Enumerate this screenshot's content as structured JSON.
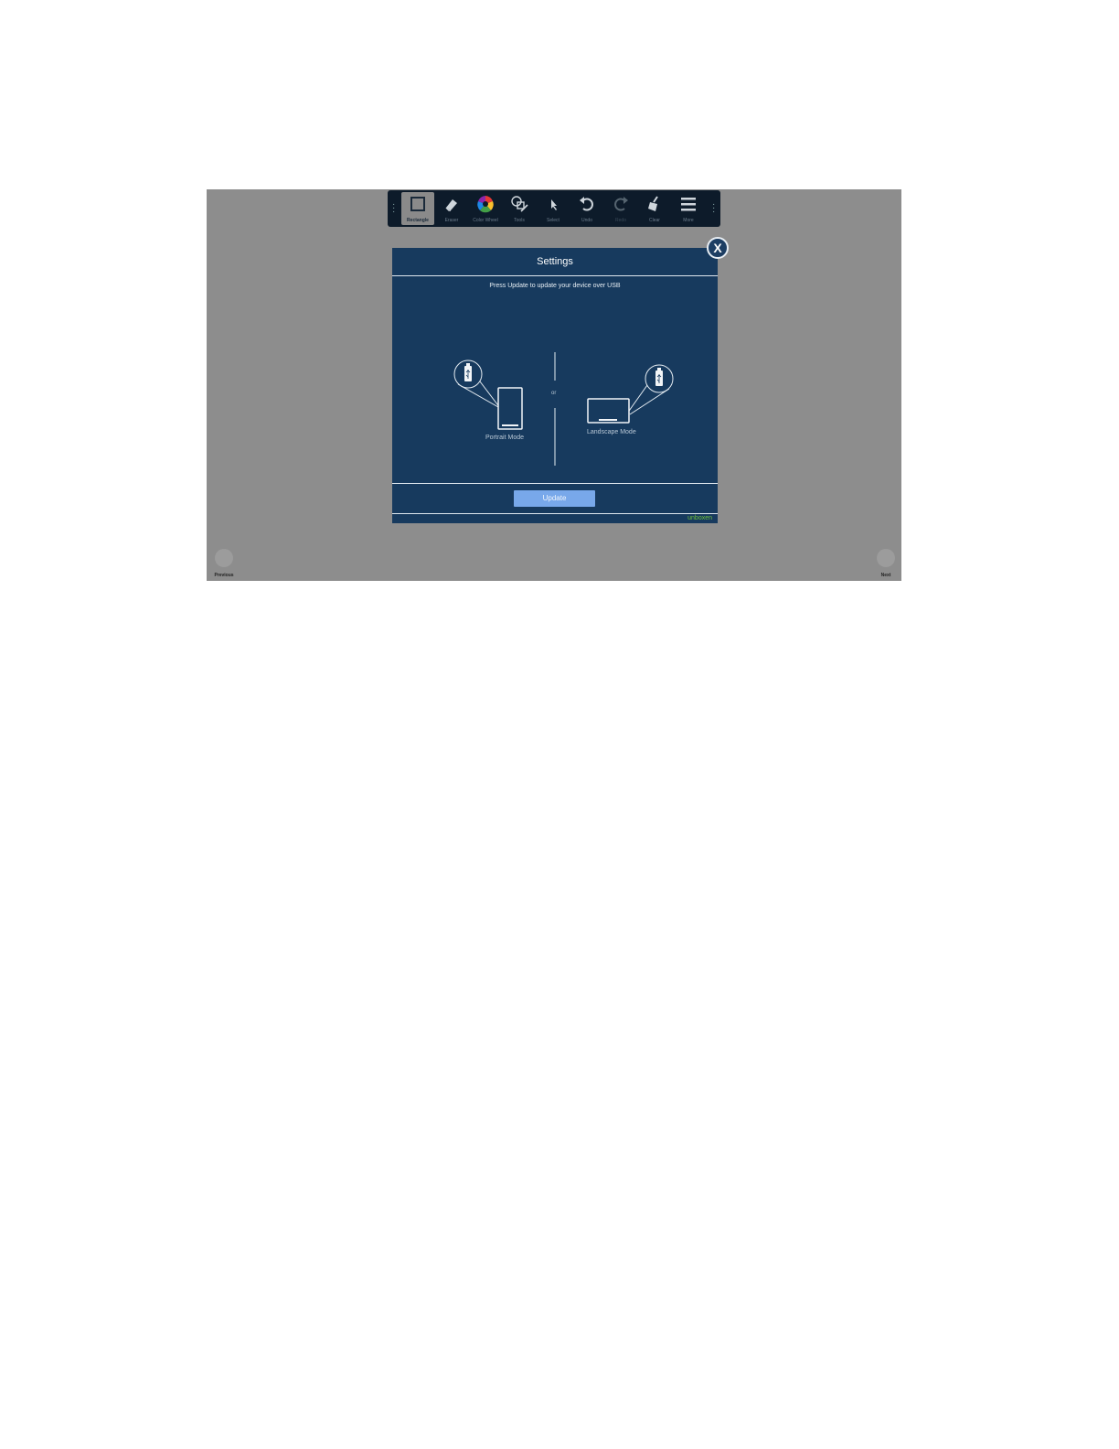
{
  "toolbar": {
    "items": [
      {
        "label": "Rectangle",
        "icon": "rectangle-icon",
        "active": true
      },
      {
        "label": "Eraser",
        "icon": "eraser-icon"
      },
      {
        "label": "Color Wheel",
        "icon": "color-wheel-icon"
      },
      {
        "label": "Tools",
        "icon": "tools-icon"
      },
      {
        "label": "Select",
        "icon": "pointer-icon"
      },
      {
        "label": "Undo",
        "icon": "undo-icon"
      },
      {
        "label": "Redo",
        "icon": "redo-icon"
      },
      {
        "label": "Clear",
        "icon": "broom-icon"
      },
      {
        "label": "More",
        "icon": "menu-icon"
      }
    ]
  },
  "modal": {
    "title": "Settings",
    "instruction": "Press Update to update your device over USB",
    "portrait_label": "Portrait Mode",
    "or_label": "or",
    "landscape_label": "Landscape Mode",
    "update_label": "Update",
    "brand": "unboxen",
    "close_label": "X"
  },
  "nav": {
    "previous": "Previous",
    "next": "Next"
  },
  "colors": {
    "modal_bg": "#173a5e",
    "toolbar_bg": "#0d1b2a",
    "update_button": "#78a8ea",
    "brand": "#6fc23a",
    "overlay": "#8d8d8d"
  }
}
